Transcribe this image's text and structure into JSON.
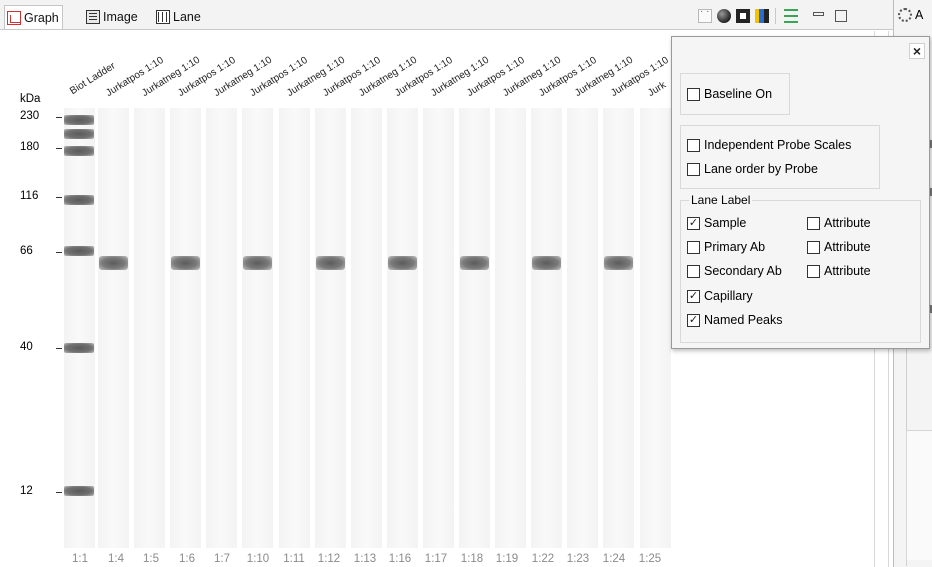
{
  "tabs": [
    {
      "label": "Graph",
      "icon": "graph-icon"
    },
    {
      "label": "Image",
      "icon": "image-icon"
    },
    {
      "label": "Lane",
      "icon": "lane-icon"
    }
  ],
  "active_tab": "Graph",
  "right_panel": {
    "tab_label": "A",
    "icon": "settings-gear-icon"
  },
  "lanes": {
    "ladder_label": "Biot Ladder",
    "sample_labels": [
      "Jurkatpos 1:10",
      "Jurkatneg 1:10",
      "Jurkatpos 1:10",
      "Jurkatneg 1:10",
      "Jurkatpos 1:10",
      "Jurkatneg 1:10",
      "Jurkatpos 1:10",
      "Jurkatneg 1:10",
      "Jurkatpos 1:10",
      "Jurkatneg 1:10",
      "Jurkatpos 1:10",
      "Jurkatneg 1:10",
      "Jurkatpos 1:10",
      "Jurkatneg 1:10",
      "Jurkatpos 1:10",
      "Jurk"
    ],
    "capillaries": [
      "1:1",
      "1:4",
      "1:5",
      "1:6",
      "1:7",
      "1:10",
      "1:11",
      "1:12",
      "1:13",
      "1:16",
      "1:17",
      "1:18",
      "1:19",
      "1:22",
      "1:23",
      "1:24",
      "1:25"
    ],
    "band_present": [
      true,
      false,
      true,
      false,
      true,
      false,
      true,
      false,
      true,
      false,
      true,
      false,
      true,
      false,
      true,
      false
    ]
  },
  "kda_axis": {
    "title": "kDa",
    "markers": [
      "230",
      "180",
      "116",
      "66",
      "40",
      "12"
    ]
  },
  "popup": {
    "close_label": "×",
    "baseline_on": {
      "label": "Baseline On",
      "checked": false
    },
    "independent_probe_scales": {
      "label": "Independent Probe Scales",
      "checked": false
    },
    "lane_order_by_probe": {
      "label": "Lane order by Probe",
      "checked": false
    },
    "lane_label_group": {
      "title": "Lane Label",
      "options": [
        {
          "label": "Sample",
          "checked": true
        },
        {
          "label": "Attribute",
          "checked": false
        },
        {
          "label": "Primary Ab",
          "checked": false
        },
        {
          "label": "Attribute",
          "checked": false
        },
        {
          "label": "Secondary Ab",
          "checked": false
        },
        {
          "label": "Attribute",
          "checked": false
        },
        {
          "label": "Capillary",
          "checked": true
        },
        {
          "label": "Named Peaks",
          "checked": true
        }
      ]
    }
  }
}
